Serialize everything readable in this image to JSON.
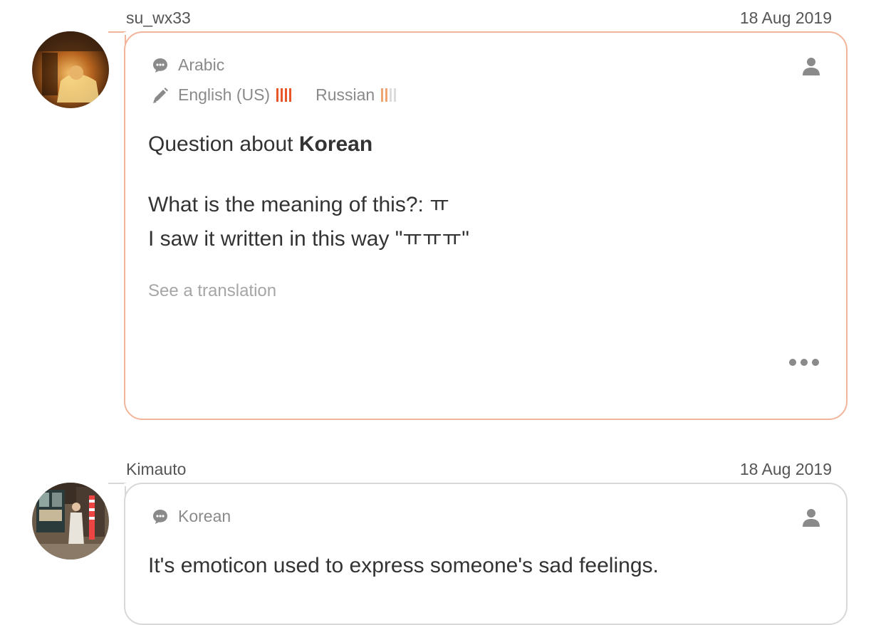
{
  "posts": [
    {
      "username": "su_wx33",
      "date": "18 Aug 2019",
      "native_language": "Arabic",
      "studying": [
        {
          "language": "English (US)",
          "level_color": "#e8572a",
          "level": 4
        },
        {
          "language": "Russian",
          "level_color": "#f0a472",
          "level": 2
        }
      ],
      "title_prefix": "Question about ",
      "title_language": "Korean",
      "body": "What is the meaning of this?: ㅠ\nI saw it written in this way \"ㅠㅠㅠ\"",
      "see_translation": "See a translation",
      "bubble_color": "#f2b59a"
    },
    {
      "username": "Kimauto",
      "date": "18 Aug 2019",
      "native_language": "Korean",
      "answer": "It's emoticon used to express someone's sad feelings.",
      "bubble_color": "#d8d8d8"
    }
  ],
  "icons": {
    "speech": "speech-bubble-icon",
    "pencil": "pencil-icon",
    "user": "user-icon",
    "more": "more-options-icon"
  }
}
